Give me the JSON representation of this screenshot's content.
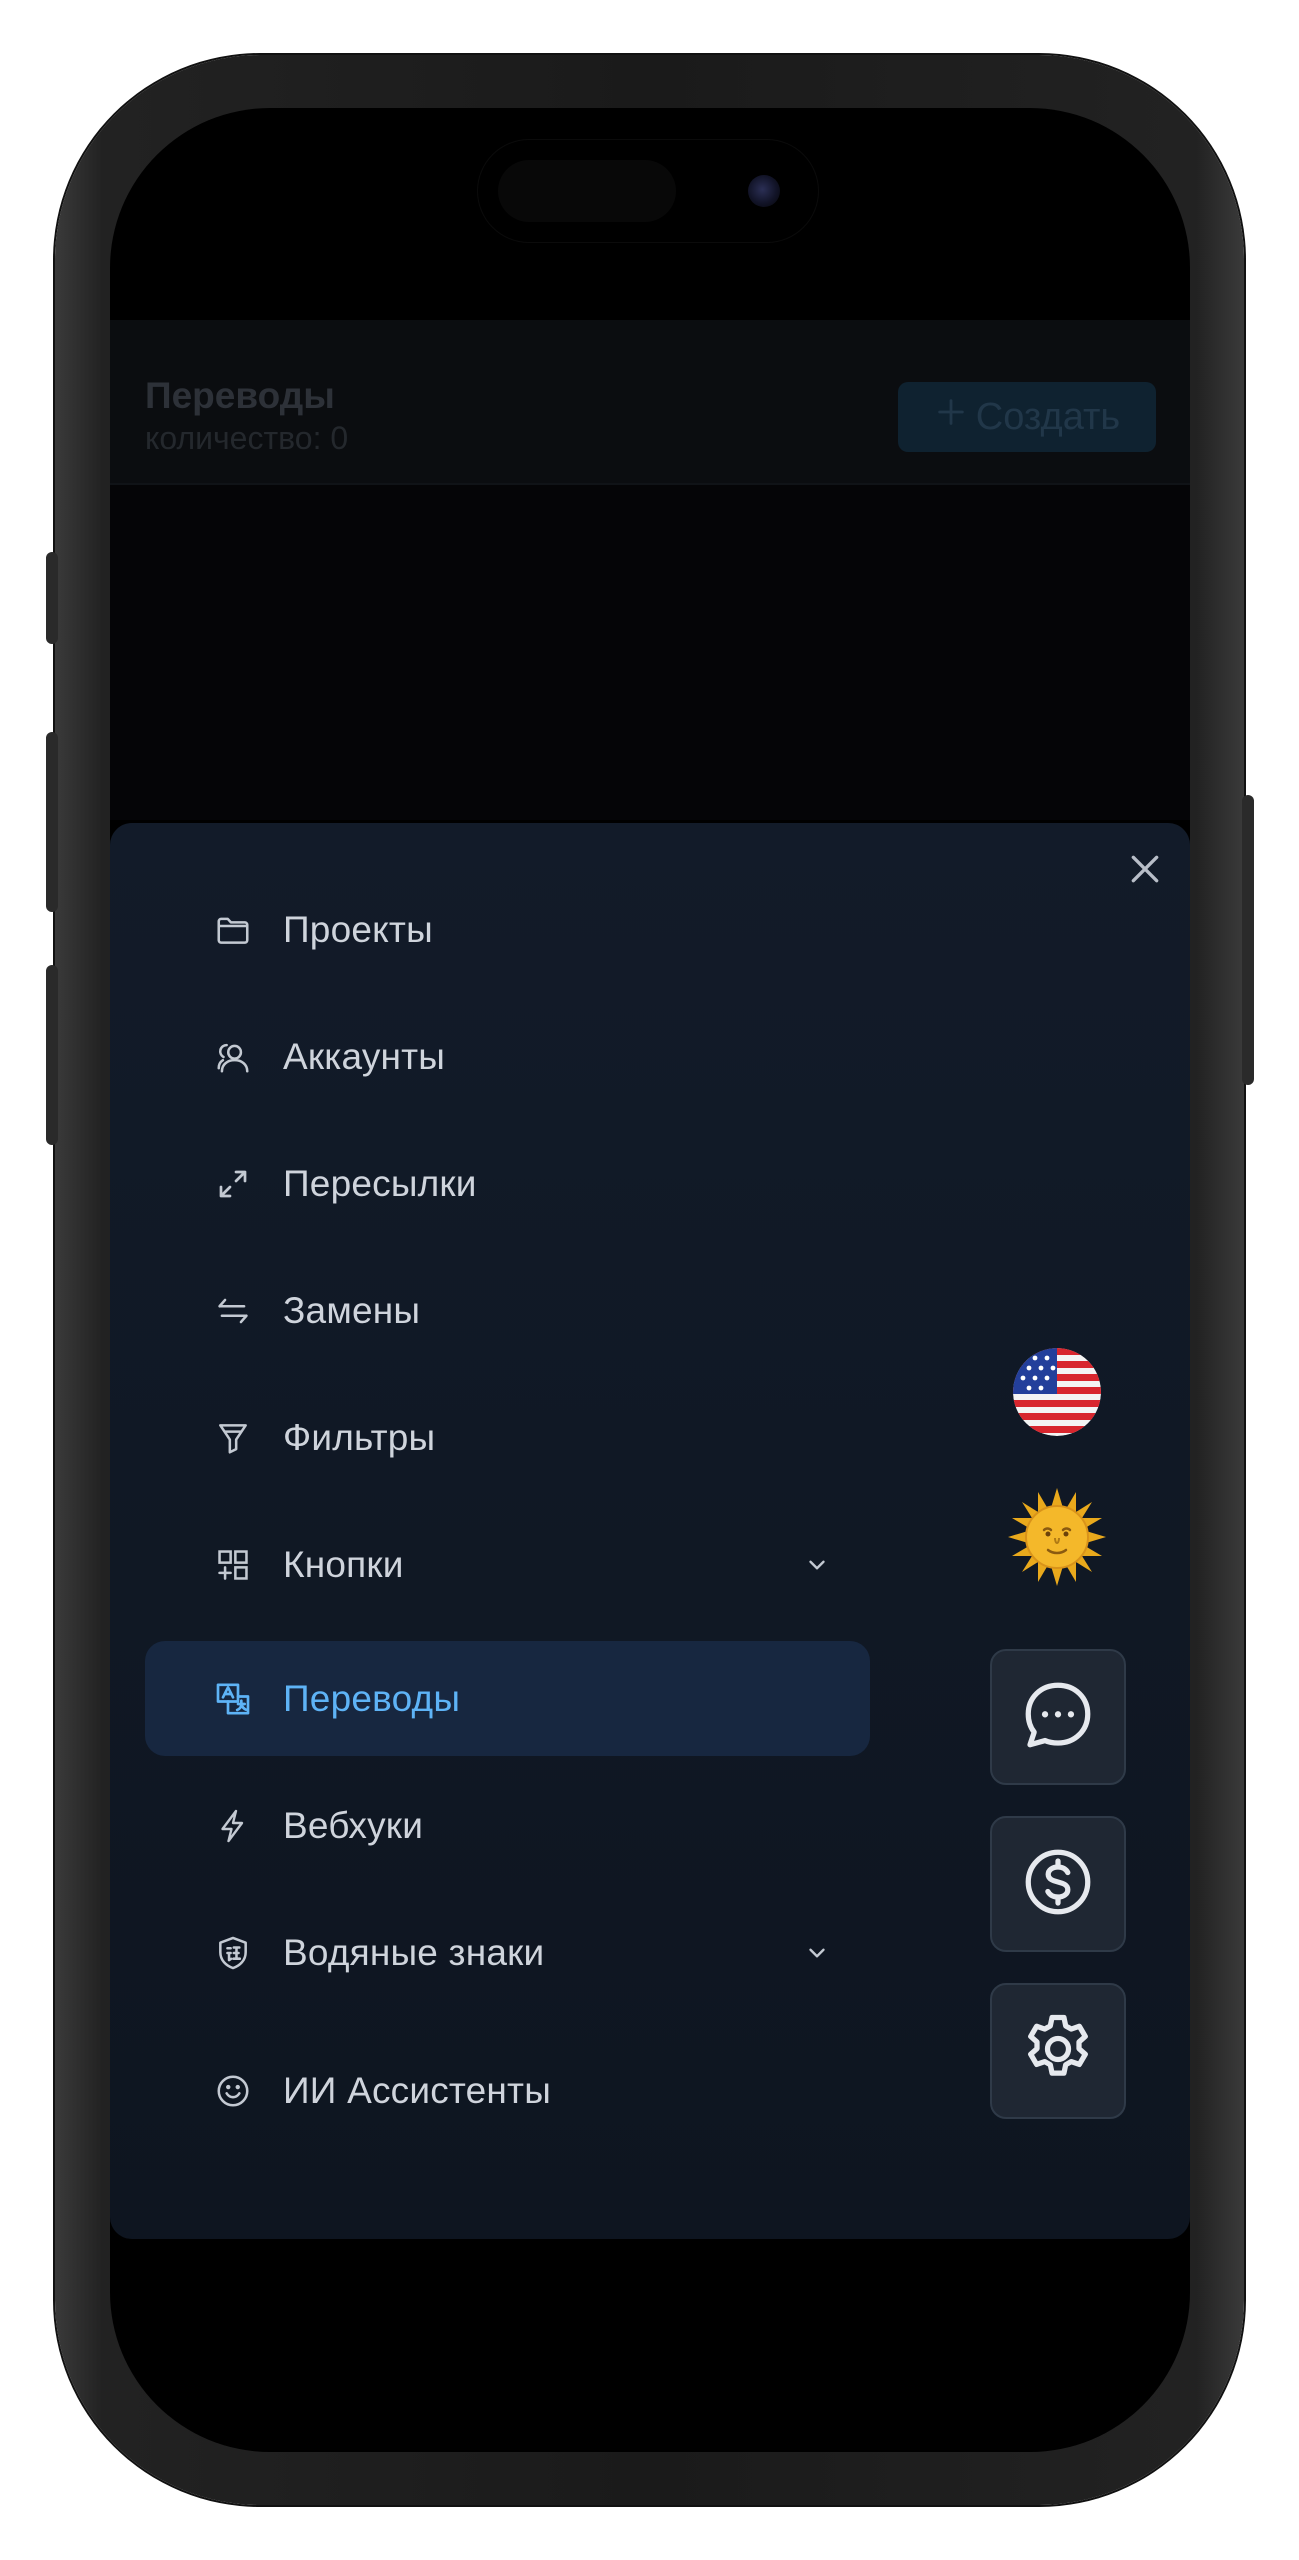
{
  "page": {
    "title": "Переводы",
    "count_text": "количество: 0",
    "create_button": {
      "icon": "plus-icon",
      "label": "Создать"
    }
  },
  "menu": {
    "items": [
      {
        "label": "Проекты",
        "icon": "folder-icon",
        "active": false,
        "expandable": false
      },
      {
        "label": "Аккаунты",
        "icon": "users-icon",
        "active": false,
        "expandable": false
      },
      {
        "label": "Пересылки",
        "icon": "arrows-diagonal-icon",
        "active": false,
        "expandable": false
      },
      {
        "label": "Замены",
        "icon": "swap-arrows-icon",
        "active": false,
        "expandable": false
      },
      {
        "label": "Фильтры",
        "icon": "filter-icon",
        "active": false,
        "expandable": false
      },
      {
        "label": "Кнопки",
        "icon": "grid-plus-icon",
        "active": false,
        "expandable": true
      },
      {
        "label": "Переводы",
        "icon": "translate-icon",
        "active": true,
        "expandable": false
      },
      {
        "label": "Вебхуки",
        "icon": "lightning-icon",
        "active": false,
        "expandable": false
      },
      {
        "label": "Водяные знаки",
        "icon": "shield-stamp-icon",
        "active": false,
        "expandable": true
      },
      {
        "label": "ИИ Ассистенты",
        "icon": "smile-icon",
        "active": false,
        "expandable": false
      }
    ]
  },
  "side_tools": {
    "language_icon": "us-flag-icon",
    "theme_icon": "sun-face-icon",
    "buttons": [
      "chat-icon",
      "dollar-icon",
      "gear-icon"
    ]
  },
  "colors": {
    "drawer_bg": "#121b29",
    "active_bg": "#172740",
    "active_text": "#5eb3f6",
    "text": "#cfd4dc",
    "icon": "#c3c9d2"
  }
}
